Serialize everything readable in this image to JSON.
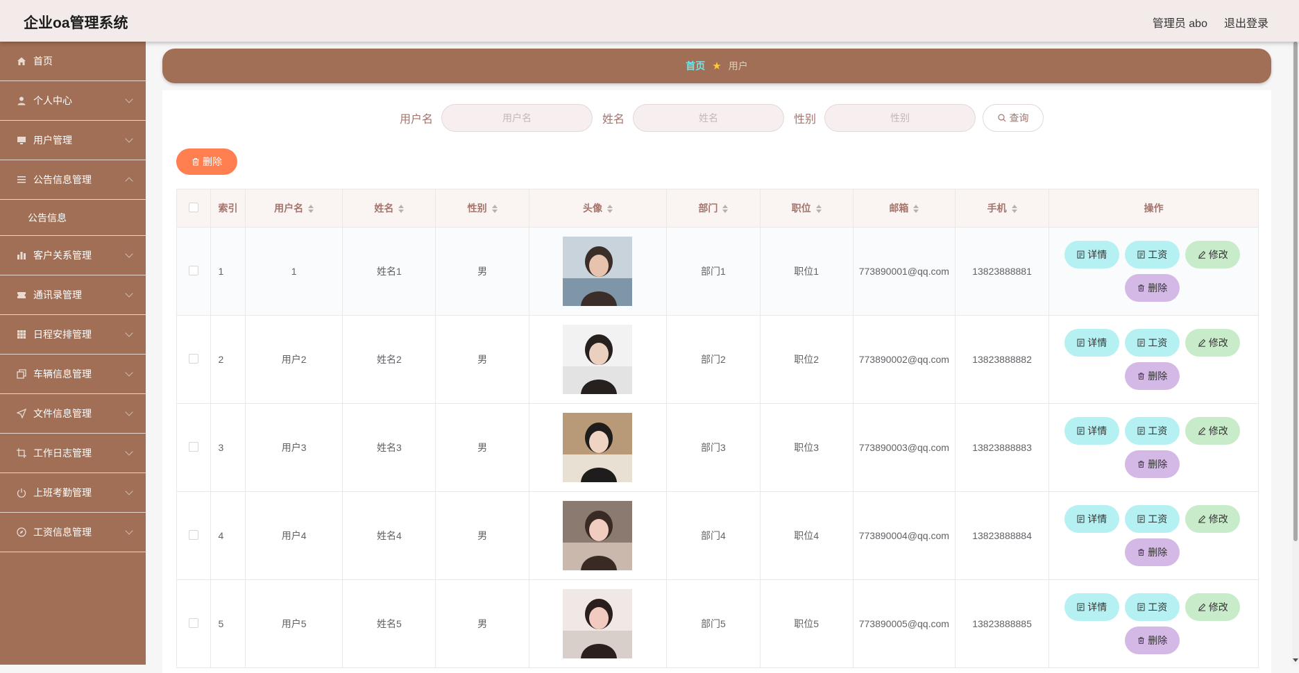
{
  "header": {
    "title": "企业oa管理系统",
    "admin_label": "管理员 abo",
    "logout_label": "退出登录"
  },
  "sidebar": {
    "items": [
      {
        "label": "首页",
        "icon": "home-icon"
      },
      {
        "label": "个人中心",
        "icon": "user-icon"
      },
      {
        "label": "用户管理",
        "icon": "monitor-icon"
      },
      {
        "label": "公告信息管理",
        "icon": "list-icon"
      },
      {
        "label": "客户关系管理",
        "icon": "chart-icon"
      },
      {
        "label": "通讯录管理",
        "icon": "ticket-icon"
      },
      {
        "label": "日程安排管理",
        "icon": "grid-icon"
      },
      {
        "label": "车辆信息管理",
        "icon": "copy-icon"
      },
      {
        "label": "文件信息管理",
        "icon": "send-icon"
      },
      {
        "label": "工作日志管理",
        "icon": "crop-icon"
      },
      {
        "label": "上班考勤管理",
        "icon": "power-icon"
      },
      {
        "label": "工资信息管理",
        "icon": "compass-icon"
      }
    ],
    "sub_item": "公告信息"
  },
  "breadcrumb": {
    "home": "首页",
    "current": "用户"
  },
  "search": {
    "username_label": "用户名",
    "username_placeholder": "用户名",
    "name_label": "姓名",
    "name_placeholder": "姓名",
    "gender_label": "性别",
    "gender_placeholder": "性别",
    "query_label": "查询"
  },
  "toolbar": {
    "delete_label": "删除"
  },
  "table": {
    "columns": [
      "索引",
      "用户名",
      "姓名",
      "性别",
      "头像",
      "部门",
      "职位",
      "邮箱",
      "手机",
      "操作"
    ],
    "rows": [
      {
        "index": "1",
        "username": "1",
        "name": "姓名1",
        "gender": "男",
        "dept": "部门1",
        "position": "职位1",
        "email": "773890001@qq.com",
        "phone": "13823888881"
      },
      {
        "index": "2",
        "username": "用户2",
        "name": "姓名2",
        "gender": "男",
        "dept": "部门2",
        "position": "职位2",
        "email": "773890002@qq.com",
        "phone": "13823888882"
      },
      {
        "index": "3",
        "username": "用户3",
        "name": "姓名3",
        "gender": "男",
        "dept": "部门3",
        "position": "职位3",
        "email": "773890003@qq.com",
        "phone": "13823888883"
      },
      {
        "index": "4",
        "username": "用户4",
        "name": "姓名4",
        "gender": "男",
        "dept": "部门4",
        "position": "职位4",
        "email": "773890004@qq.com",
        "phone": "13823888884"
      },
      {
        "index": "5",
        "username": "用户5",
        "name": "姓名5",
        "gender": "男",
        "dept": "部门5",
        "position": "职位5",
        "email": "773890005@qq.com",
        "phone": "13823888885"
      }
    ],
    "actions": {
      "detail": "详情",
      "salary": "工资",
      "edit": "修改",
      "delete": "删除"
    }
  },
  "colors": {
    "header_bg": "#f2ebea",
    "sidebar_bg": "#a06f55",
    "accent_orange": "#ff7f50",
    "label_brown": "#a4746b",
    "btn_cyan": "#b5f1f2",
    "btn_green": "#c8ebc9",
    "btn_purple": "#d4b8e6"
  }
}
